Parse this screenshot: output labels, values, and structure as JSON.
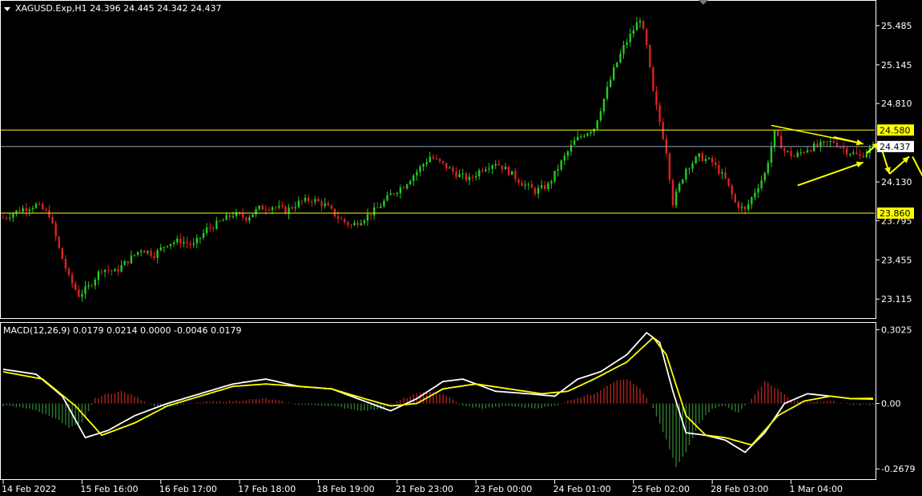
{
  "colors": {
    "background": "#000000",
    "axis": "#ffffff",
    "bull": "#22cc22",
    "bear": "#dd2222",
    "level_line": "#ffff00",
    "current_line": "#8fa3b8",
    "macd_line": "#ffffff",
    "signal_line": "#ffff00",
    "hist_pos": "#b22222",
    "hist_neg": "#2f7a2f",
    "annotation": "#ffff00"
  },
  "header": {
    "symbol_line": "XAGUSD.Exp,H1  24.396 24.445 24.342 24.437"
  },
  "macd_header": {
    "text": "MACD(12,26,9) 0.0179 0.0214 0.0000 -0.0046 0.0179"
  },
  "chart_data": [
    {
      "type": "candlestick",
      "title": "XAGUSD.Exp,H1  24.396 24.445 24.342 24.437",
      "ylim": [
        22.95,
        25.7
      ],
      "yticks": [
        "25.485",
        "25.145",
        "24.810",
        "24.130",
        "23.795",
        "23.455",
        "23.115"
      ],
      "ytick_values": [
        25.485,
        25.145,
        24.81,
        24.13,
        23.795,
        23.455,
        23.115
      ],
      "xtick_labels": [
        "14 Feb 2022",
        "15 Feb 16:00",
        "16 Feb 17:00",
        "17 Feb 18:00",
        "18 Feb 19:00",
        "21 Feb 23:00",
        "23 Feb 00:00",
        "24 Feb 01:00",
        "25 Feb 02:00",
        "28 Feb 03:00",
        "1 Mar 04:00"
      ],
      "horizontal_levels": [
        {
          "value": 24.58,
          "label": "24.580"
        },
        {
          "value": 23.86,
          "label": "23.860"
        }
      ],
      "current_price": {
        "value": 24.437,
        "label": "24.437"
      },
      "close_path": [
        [
          0,
          23.82
        ],
        [
          6,
          23.9
        ],
        [
          10,
          23.93
        ],
        [
          14,
          23.85
        ],
        [
          17,
          23.55
        ],
        [
          20,
          23.3
        ],
        [
          23,
          23.15
        ],
        [
          26,
          23.22
        ],
        [
          30,
          23.38
        ],
        [
          34,
          23.35
        ],
        [
          38,
          23.45
        ],
        [
          42,
          23.55
        ],
        [
          46,
          23.5
        ],
        [
          50,
          23.6
        ],
        [
          54,
          23.62
        ],
        [
          58,
          23.58
        ],
        [
          62,
          23.72
        ],
        [
          66,
          23.78
        ],
        [
          70,
          23.85
        ],
        [
          74,
          23.82
        ],
        [
          78,
          23.9
        ],
        [
          82,
          23.92
        ],
        [
          86,
          23.88
        ],
        [
          90,
          23.95
        ],
        [
          94,
          23.98
        ],
        [
          98,
          23.93
        ],
        [
          102,
          23.82
        ],
        [
          106,
          23.75
        ],
        [
          110,
          23.82
        ],
        [
          114,
          23.9
        ],
        [
          118,
          24.02
        ],
        [
          122,
          24.1
        ],
        [
          126,
          24.22
        ],
        [
          130,
          24.35
        ],
        [
          134,
          24.28
        ],
        [
          138,
          24.2
        ],
        [
          142,
          24.15
        ],
        [
          146,
          24.25
        ],
        [
          150,
          24.3
        ],
        [
          154,
          24.22
        ],
        [
          158,
          24.12
        ],
        [
          162,
          24.05
        ],
        [
          166,
          24.1
        ],
        [
          170,
          24.3
        ],
        [
          174,
          24.48
        ],
        [
          177,
          24.55
        ],
        [
          180,
          24.6
        ],
        [
          183,
          24.85
        ],
        [
          186,
          25.1
        ],
        [
          189,
          25.3
        ],
        [
          192,
          25.45
        ],
        [
          194,
          25.55
        ],
        [
          196,
          25.3
        ],
        [
          198,
          24.9
        ],
        [
          200,
          24.65
        ],
        [
          202,
          24.4
        ],
        [
          204,
          23.95
        ],
        [
          206,
          24.1
        ],
        [
          208,
          24.25
        ],
        [
          212,
          24.35
        ],
        [
          216,
          24.3
        ],
        [
          220,
          24.15
        ],
        [
          223,
          23.95
        ],
        [
          226,
          23.88
        ],
        [
          229,
          24.05
        ],
        [
          232,
          24.2
        ],
        [
          235,
          24.55
        ],
        [
          238,
          24.4
        ],
        [
          241,
          24.35
        ],
        [
          245,
          24.42
        ],
        [
          249,
          24.45
        ],
        [
          253,
          24.48
        ],
        [
          257,
          24.4
        ],
        [
          261,
          24.35
        ],
        [
          265,
          24.437
        ]
      ]
    },
    {
      "type": "line",
      "title": "MACD(12,26,9) 0.0179 0.0214 0.0000 -0.0046 0.0179",
      "ylim": [
        -0.31,
        0.33
      ],
      "yticks": [
        "0.3025",
        "0.00",
        "-0.2679"
      ],
      "ytick_values": [
        0.3025,
        0.0,
        -0.2679
      ],
      "series": [
        {
          "role": "macd",
          "points": [
            [
              0,
              0.14
            ],
            [
              10,
              0.12
            ],
            [
              18,
              0.03
            ],
            [
              25,
              -0.14
            ],
            [
              32,
              -0.11
            ],
            [
              40,
              -0.05
            ],
            [
              50,
              0.0
            ],
            [
              60,
              0.04
            ],
            [
              70,
              0.08
            ],
            [
              80,
              0.1
            ],
            [
              90,
              0.07
            ],
            [
              100,
              0.06
            ],
            [
              110,
              0.01
            ],
            [
              118,
              -0.03
            ],
            [
              126,
              0.02
            ],
            [
              134,
              0.09
            ],
            [
              140,
              0.1
            ],
            [
              150,
              0.05
            ],
            [
              160,
              0.04
            ],
            [
              168,
              0.03
            ],
            [
              175,
              0.1
            ],
            [
              182,
              0.13
            ],
            [
              190,
              0.2
            ],
            [
              196,
              0.29
            ],
            [
              200,
              0.25
            ],
            [
              204,
              0.05
            ],
            [
              208,
              -0.12
            ],
            [
              214,
              -0.13
            ],
            [
              220,
              -0.15
            ],
            [
              226,
              -0.2
            ],
            [
              232,
              -0.12
            ],
            [
              238,
              0.0
            ],
            [
              245,
              0.04
            ],
            [
              252,
              0.03
            ],
            [
              258,
              0.02
            ],
            [
              265,
              0.018
            ]
          ]
        },
        {
          "role": "signal",
          "points": [
            [
              0,
              0.13
            ],
            [
              12,
              0.1
            ],
            [
              22,
              -0.01
            ],
            [
              30,
              -0.13
            ],
            [
              40,
              -0.08
            ],
            [
              50,
              -0.01
            ],
            [
              60,
              0.03
            ],
            [
              70,
              0.07
            ],
            [
              80,
              0.08
            ],
            [
              90,
              0.07
            ],
            [
              100,
              0.06
            ],
            [
              110,
              0.02
            ],
            [
              118,
              -0.01
            ],
            [
              126,
              0.0
            ],
            [
              134,
              0.06
            ],
            [
              144,
              0.08
            ],
            [
              154,
              0.06
            ],
            [
              164,
              0.04
            ],
            [
              172,
              0.05
            ],
            [
              180,
              0.1
            ],
            [
              190,
              0.17
            ],
            [
              198,
              0.27
            ],
            [
              202,
              0.2
            ],
            [
              208,
              -0.05
            ],
            [
              214,
              -0.13
            ],
            [
              220,
              -0.14
            ],
            [
              228,
              -0.17
            ],
            [
              236,
              -0.05
            ],
            [
              244,
              0.01
            ],
            [
              252,
              0.03
            ],
            [
              258,
              0.02
            ],
            [
              265,
              0.021
            ]
          ]
        },
        {
          "role": "histogram",
          "points": [
            [
              0,
              -0.01
            ],
            [
              8,
              -0.02
            ],
            [
              16,
              -0.06
            ],
            [
              20,
              -0.1
            ],
            [
              24,
              -0.08
            ],
            [
              28,
              0.02
            ],
            [
              32,
              0.04
            ],
            [
              36,
              0.05
            ],
            [
              40,
              0.03
            ],
            [
              46,
              -0.01
            ],
            [
              52,
              -0.01
            ],
            [
              60,
              0.005
            ],
            [
              70,
              0.01
            ],
            [
              80,
              0.02
            ],
            [
              90,
              -0.005
            ],
            [
              100,
              -0.01
            ],
            [
              110,
              -0.03
            ],
            [
              116,
              -0.02
            ],
            [
              122,
              0.02
            ],
            [
              128,
              0.05
            ],
            [
              134,
              0.04
            ],
            [
              140,
              -0.01
            ],
            [
              146,
              -0.02
            ],
            [
              154,
              -0.01
            ],
            [
              162,
              -0.02
            ],
            [
              168,
              -0.01
            ],
            [
              174,
              0.02
            ],
            [
              180,
              0.04
            ],
            [
              186,
              0.09
            ],
            [
              190,
              0.1
            ],
            [
              194,
              0.06
            ],
            [
              198,
              -0.02
            ],
            [
              202,
              -0.15
            ],
            [
              205,
              -0.26
            ],
            [
              208,
              -0.2
            ],
            [
              212,
              -0.08
            ],
            [
              216,
              -0.02
            ],
            [
              220,
              -0.01
            ],
            [
              224,
              -0.04
            ],
            [
              228,
              0.02
            ],
            [
              232,
              0.09
            ],
            [
              236,
              0.06
            ],
            [
              240,
              0.01
            ],
            [
              246,
              0.005
            ],
            [
              252,
              0.01
            ],
            [
              258,
              -0.005
            ],
            [
              265,
              -0.0046
            ]
          ]
        }
      ]
    }
  ]
}
